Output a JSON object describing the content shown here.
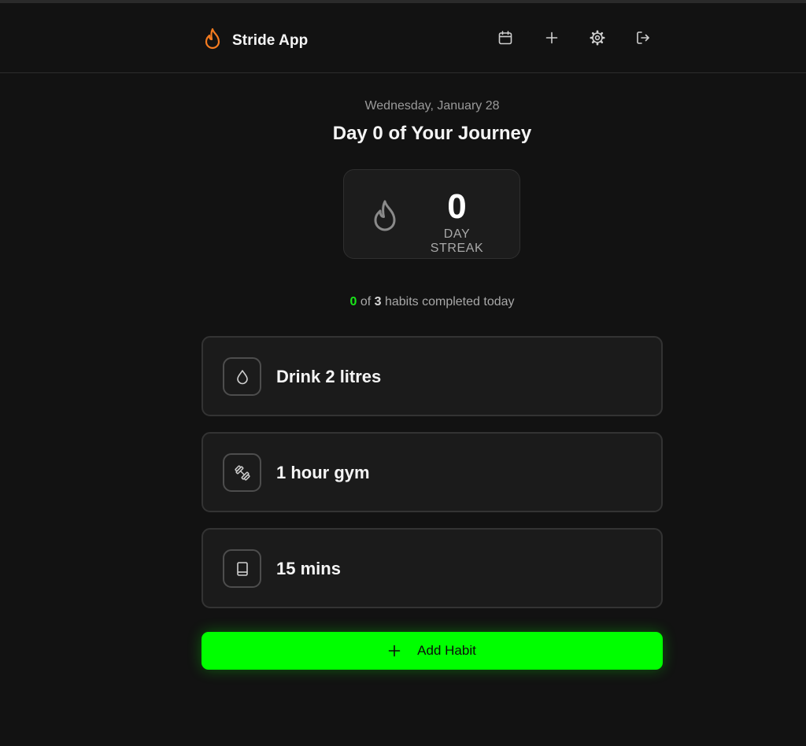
{
  "app": {
    "title": "Stride App",
    "brand_color": "#f47b20",
    "accent_color": "#00ff00"
  },
  "header": {
    "icons": [
      "flame-icon",
      "calendar-icon",
      "plus-icon",
      "gear-icon",
      "logout-icon"
    ]
  },
  "main": {
    "date": "Wednesday, January 28",
    "journey_title": "Day 0 of Your Journey",
    "streak": {
      "value": "0",
      "label": "DAY STREAK"
    },
    "progress": {
      "completed": "0",
      "middle": " of ",
      "total": "3",
      "suffix": " habits completed today"
    },
    "habits": [
      {
        "name": "Drink 2 litres",
        "icon": "droplet-icon"
      },
      {
        "name": "1 hour gym",
        "icon": "dumbbell-icon"
      },
      {
        "name": "15 mins",
        "icon": "book-icon"
      }
    ],
    "add_button": {
      "label": "Add Habit",
      "icon": "plus-icon"
    }
  }
}
